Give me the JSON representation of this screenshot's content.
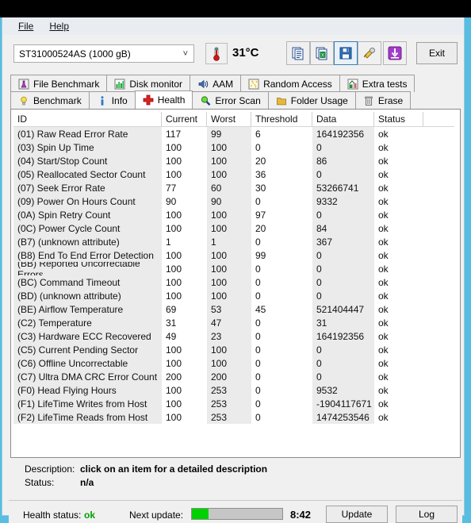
{
  "window": {
    "menu": [
      {
        "label": "File",
        "accel": "F"
      },
      {
        "label": "Help",
        "accel": "H"
      }
    ]
  },
  "toolbar": {
    "drive_selected": "ST31000524AS (1000 gB)",
    "drive_chevron": "˅",
    "temperature": "31°C",
    "temp_icon": "thermometer-icon",
    "buttons": [
      {
        "name": "copy-report-icon",
        "selected": false
      },
      {
        "name": "export-excel-icon",
        "selected": false
      },
      {
        "name": "save-icon",
        "selected": true
      },
      {
        "name": "tools-icon",
        "selected": false
      },
      {
        "name": "download-icon",
        "selected": false
      }
    ],
    "exit_label": "Exit"
  },
  "tabs": {
    "row1": [
      {
        "label": "File Benchmark",
        "icon": "flask-icon",
        "active": false
      },
      {
        "label": "Disk monitor",
        "icon": "bar-chart-icon",
        "active": false
      },
      {
        "label": "AAM",
        "icon": "speaker-icon",
        "active": false
      },
      {
        "label": "Random Access",
        "icon": "scatter-icon",
        "active": false
      },
      {
        "label": "Extra tests",
        "icon": "chart-grid-icon",
        "active": false
      }
    ],
    "row2": [
      {
        "label": "Benchmark",
        "icon": "bulb-icon",
        "active": false
      },
      {
        "label": "Info",
        "icon": "info-icon",
        "active": false
      },
      {
        "label": "Health",
        "icon": "red-cross-icon",
        "active": true
      },
      {
        "label": "Error Scan",
        "icon": "magnifier-icon",
        "active": false
      },
      {
        "label": "Folder Usage",
        "icon": "folder-icon",
        "active": false
      },
      {
        "label": "Erase",
        "icon": "trash-icon",
        "active": false
      }
    ]
  },
  "table": {
    "columns": [
      "ID",
      "Current",
      "Worst",
      "Threshold",
      "Data",
      "Status"
    ],
    "rows": [
      [
        "(01) Raw Read Error Rate",
        "117",
        "99",
        "6",
        "164192356",
        "ok"
      ],
      [
        "(03) Spin Up Time",
        "100",
        "100",
        "0",
        "0",
        "ok"
      ],
      [
        "(04) Start/Stop Count",
        "100",
        "100",
        "20",
        "86",
        "ok"
      ],
      [
        "(05) Reallocated Sector Count",
        "100",
        "100",
        "36",
        "0",
        "ok"
      ],
      [
        "(07) Seek Error Rate",
        "77",
        "60",
        "30",
        "53266741",
        "ok"
      ],
      [
        "(09) Power On Hours Count",
        "90",
        "90",
        "0",
        "9332",
        "ok"
      ],
      [
        "(0A) Spin Retry Count",
        "100",
        "100",
        "97",
        "0",
        "ok"
      ],
      [
        "(0C) Power Cycle Count",
        "100",
        "100",
        "20",
        "84",
        "ok"
      ],
      [
        "(B7) (unknown attribute)",
        "1",
        "1",
        "0",
        "367",
        "ok"
      ],
      [
        "(B8) End To End Error Detection",
        "100",
        "100",
        "99",
        "0",
        "ok"
      ],
      [
        "(BB) Reported Uncorrectable Errors",
        "100",
        "100",
        "0",
        "0",
        "ok"
      ],
      [
        "(BC) Command Timeout",
        "100",
        "100",
        "0",
        "0",
        "ok"
      ],
      [
        "(BD) (unknown attribute)",
        "100",
        "100",
        "0",
        "0",
        "ok"
      ],
      [
        "(BE) Airflow Temperature",
        "69",
        "53",
        "45",
        "521404447",
        "ok"
      ],
      [
        "(C2) Temperature",
        "31",
        "47",
        "0",
        "31",
        "ok"
      ],
      [
        "(C3) Hardware ECC Recovered",
        "49",
        "23",
        "0",
        "164192356",
        "ok"
      ],
      [
        "(C5) Current Pending Sector",
        "100",
        "100",
        "0",
        "0",
        "ok"
      ],
      [
        "(C6) Offline Uncorrectable",
        "100",
        "100",
        "0",
        "0",
        "ok"
      ],
      [
        "(C7) Ultra DMA CRC Error Count",
        "200",
        "200",
        "0",
        "0",
        "ok"
      ],
      [
        "(F0) Head Flying Hours",
        "100",
        "253",
        "0",
        "9532",
        "ok"
      ],
      [
        "(F1) LifeTime Writes from Host",
        "100",
        "253",
        "0",
        "-1904117671",
        "ok"
      ],
      [
        "(F2) LifeTime Reads from Host",
        "100",
        "253",
        "0",
        "1474253546",
        "ok"
      ]
    ]
  },
  "details": {
    "description_label": "Description:",
    "description_value": "click on an item for a detailed description",
    "status_label": "Status:",
    "status_value": "n/a"
  },
  "statusbar": {
    "health_label": "Health status:",
    "health_value": "ok",
    "next_update_label": "Next update:",
    "progress_percent": 18,
    "time_remaining": "8:42",
    "update_button": "Update",
    "log_button": "Log"
  },
  "colors": {
    "accent": "#57bde1",
    "ok_green": "#00a000",
    "progress_green": "#00d200",
    "panel_bg": "#f0f0f0"
  }
}
